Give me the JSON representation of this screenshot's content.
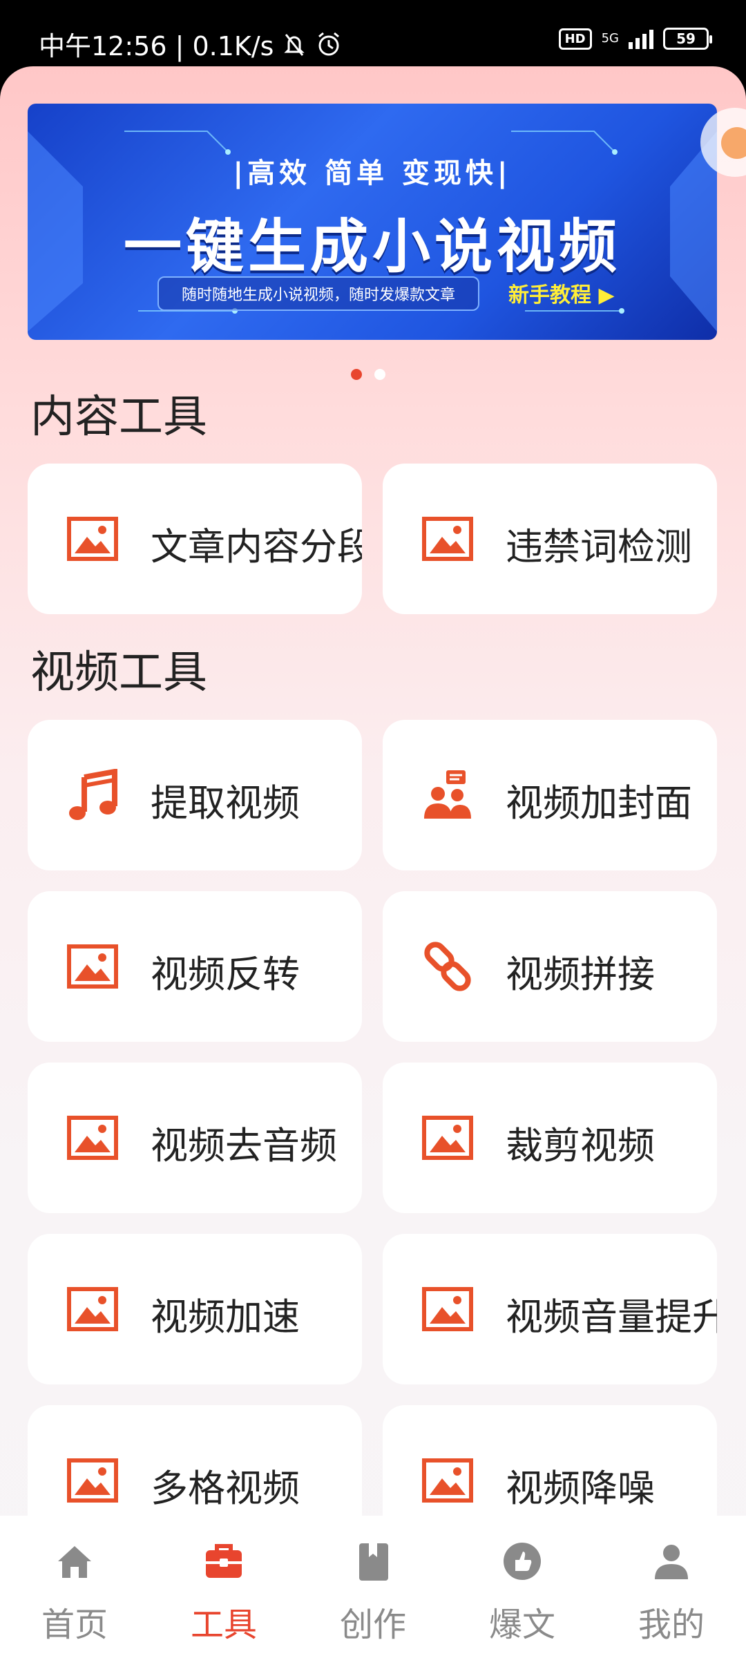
{
  "status_bar": {
    "time_and_speed": "中午12:56 | 0.1K/s",
    "hd": "HD",
    "network": "5G",
    "battery": "59"
  },
  "banner": {
    "tagline": "|高效 简单 变现快|",
    "title": "一键生成小说视频",
    "subtitle": "随时随地生成小说视频，随时发爆款文章",
    "cta": "新手教程 ▶"
  },
  "sections": {
    "content_tools": "内容工具",
    "video_tools": "视频工具"
  },
  "tools": {
    "article_segment": "文章内容分段",
    "banned_word_check": "违禁词检测",
    "extract_video": "提取视频",
    "add_cover": "视频加封面",
    "reverse": "视频反转",
    "splice": "视频拼接",
    "remove_audio": "视频去音频",
    "crop": "裁剪视频",
    "speed_up": "视频加速",
    "volume_boost": "视频音量提升",
    "grid_video": "多格视频",
    "denoise": "视频降噪"
  },
  "nav": {
    "home": "首页",
    "tools": "工具",
    "create": "创作",
    "viral": "爆文",
    "mine": "我的"
  },
  "colors": {
    "accent": "#e8452e",
    "icon": "#e8512a",
    "nav_inactive": "#8a8a8a"
  }
}
